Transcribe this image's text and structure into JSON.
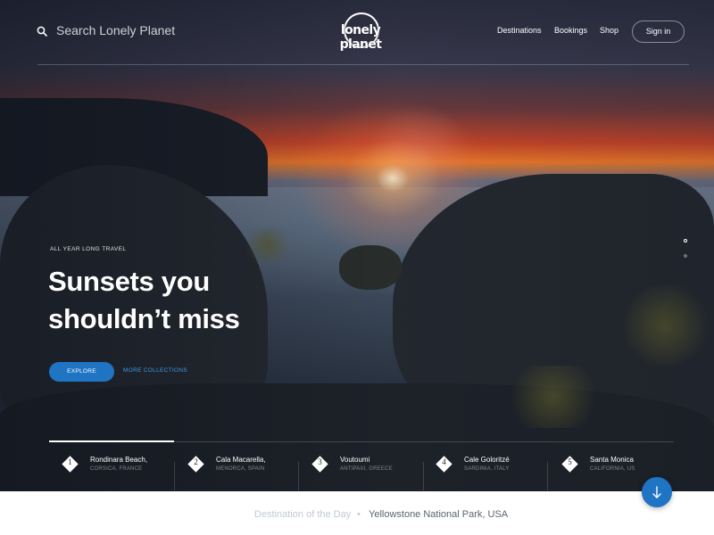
{
  "header": {
    "search_placeholder": "Search Lonely Planet",
    "logo_text": "lonely planet",
    "nav": [
      "Destinations",
      "Bookings",
      "Shop"
    ],
    "signin_label": "Sign in"
  },
  "hero": {
    "eyebrow": "ALL YEAR LONG TRAVEL",
    "headline_line1": "Sunsets you",
    "headline_line2": "shouldn’t miss",
    "explore_label": "EXPLORE",
    "more_label": "MORE COLLECTIONS",
    "slides": [
      {
        "active": true
      },
      {
        "active": false
      }
    ]
  },
  "destinations": [
    {
      "num": "1",
      "name": "Rondinara Beach,",
      "sub": "CORSICA, FRANCE",
      "active": true
    },
    {
      "num": "2",
      "name": "Cala Macarella,",
      "sub": "MENORCA, SPAIN",
      "active": false
    },
    {
      "num": "3",
      "name": "Voutoumi",
      "sub": "ANTIPAXI, GREECE",
      "active": false
    },
    {
      "num": "4",
      "name": "Cale Goloritzé",
      "sub": "SARDINIA, ITALY",
      "active": false
    },
    {
      "num": "5",
      "name": "Santa Monica",
      "sub": "CALIFORNIA, US",
      "active": false
    }
  ],
  "footer": {
    "label": "Destination of the Day",
    "bullet": "•",
    "value": "Yellowstone National Park, USA"
  },
  "colors": {
    "accent": "#1f74c4",
    "link": "#3d9ae8"
  }
}
